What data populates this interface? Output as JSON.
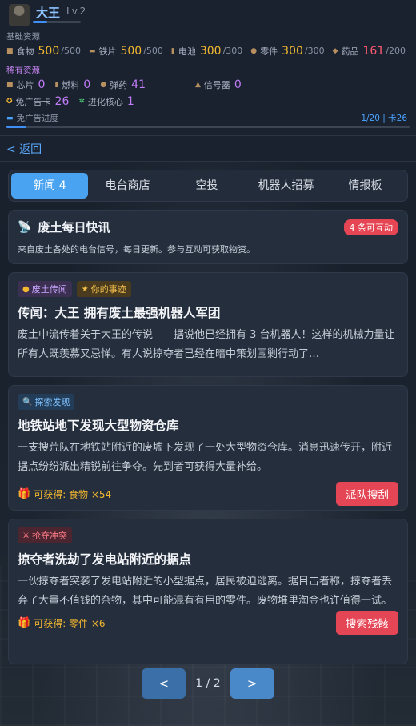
{
  "player": {
    "name": "大王",
    "level": "Lv.2"
  },
  "resources": {
    "section_label": "基础资源",
    "items": [
      {
        "label": "食物",
        "value": "500",
        "max": "/500",
        "color": "yellow",
        "icon": "food-icon"
      },
      {
        "label": "铁片",
        "value": "500",
        "max": "/500",
        "color": "yellow",
        "icon": "iron-icon"
      },
      {
        "label": "电池",
        "value": "300",
        "max": "/300",
        "color": "yellow",
        "icon": "battery-icon"
      },
      {
        "label": "零件",
        "value": "300",
        "max": "/300",
        "color": "yellow",
        "icon": "parts-icon"
      },
      {
        "label": "药品",
        "value": "161",
        "max": "/200",
        "color": "red",
        "icon": "medicine-icon"
      }
    ]
  },
  "rare": {
    "section_label": "稀有资源",
    "row1": [
      {
        "label": "芯片",
        "value": "0",
        "icon": "chip-icon"
      },
      {
        "label": "燃料",
        "value": "0",
        "icon": "fuel-icon"
      },
      {
        "label": "弹药",
        "value": "41",
        "icon": "ammo-icon"
      },
      {
        "label": "信号器",
        "value": "0",
        "icon": "signal-icon"
      }
    ],
    "row2": [
      {
        "label": "免广告卡",
        "value": "26",
        "icon": "ad-card-icon"
      },
      {
        "label": "进化核心",
        "value": "1",
        "icon": "core-icon"
      }
    ]
  },
  "ad_progress": {
    "label": "免广告进度",
    "value_text": "1/20 | 卡26",
    "fraction": 0.05
  },
  "back_label": "< 返回",
  "tabs": [
    {
      "label": "新闻 4",
      "active": true
    },
    {
      "label": "电台商店"
    },
    {
      "label": "空投"
    },
    {
      "label": "机器人招募"
    },
    {
      "label": "情报板"
    }
  ],
  "intro": {
    "title": "废土每日快讯",
    "badge": "4 条可互动",
    "desc": "来自废土各处的电台信号，每日更新。参与互动可获取物资。"
  },
  "news": [
    {
      "tags": [
        {
          "text": "废土传闻",
          "style": "purple"
        },
        {
          "text": "你的事迹",
          "style": "gold"
        }
      ],
      "title": "传闻：大王 拥有废土最强机器人军团",
      "body": "废土中流传着关于大王的传说——据说他已经拥有 3 台机器人！这样的机械力量让所有人既羡慕又忌惮。有人说掠夺者已经在暗中策划围剿行动了…"
    },
    {
      "tags": [
        {
          "text": "探索发现",
          "style": "blue"
        }
      ],
      "title": "地铁站地下发现大型物资仓库",
      "body": "一支搜荒队在地铁站附近的废墟下发现了一处大型物资仓库。消息迅速传开，附近据点纷纷派出精锐前往争夺。先到者可获得大量补给。",
      "reward": "可获得: 食物 ×54",
      "action": "派队搜刮"
    },
    {
      "tags": [
        {
          "text": "抢夺冲突",
          "style": "red"
        }
      ],
      "title": "掠夺者洗劫了发电站附近的据点",
      "body": "一伙掠夺者突袭了发电站附近的小型据点，居民被迫逃离。据目击者称，掠夺者丢弃了大量不值钱的杂物，其中可能混有有用的零件。废物堆里淘金也许值得一试。",
      "reward": "可获得: 零件 ×6",
      "action": "搜索残骸"
    }
  ],
  "pager": {
    "prev": "<",
    "info": "1 / 2",
    "next": ">"
  }
}
